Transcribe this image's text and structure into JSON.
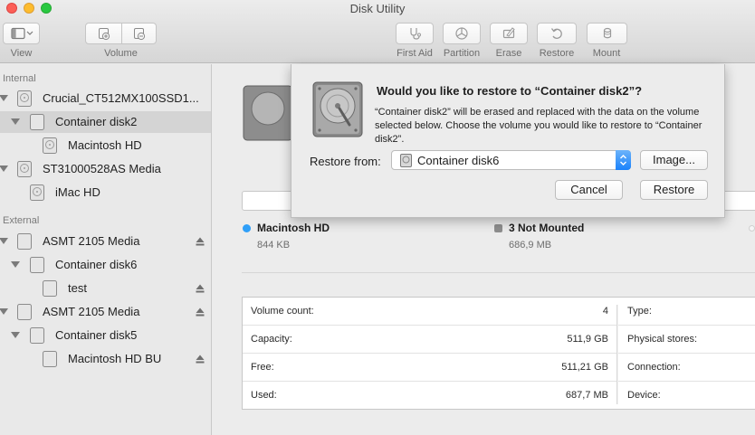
{
  "window": {
    "title": "Disk Utility"
  },
  "toolbar": {
    "view_label": "View",
    "volume_label": "Volume",
    "first_aid_label": "First Aid",
    "partition_label": "Partition",
    "erase_label": "Erase",
    "restore_label": "Restore",
    "mount_label": "Mount"
  },
  "sidebar": {
    "internal_header": "Internal",
    "external_header": "External",
    "items": [
      {
        "label": "Crucial_CT512MX100SSD1...",
        "kind": "drive"
      },
      {
        "label": "Container disk2",
        "kind": "container",
        "selected": true
      },
      {
        "label": "Macintosh HD",
        "kind": "volume"
      },
      {
        "label": "ST31000528AS Media",
        "kind": "drive"
      },
      {
        "label": "iMac HD",
        "kind": "volume"
      },
      {
        "label": "ASMT 2105 Media",
        "kind": "drive"
      },
      {
        "label": "Container disk6",
        "kind": "container"
      },
      {
        "label": "test",
        "kind": "volume"
      },
      {
        "label": "ASMT 2105 Media",
        "kind": "drive"
      },
      {
        "label": "Container disk5",
        "kind": "container"
      },
      {
        "label": "Macintosh HD BU",
        "kind": "volume"
      }
    ]
  },
  "main": {
    "legend": [
      {
        "name": "Macintosh HD",
        "size": "844 KB",
        "color": "#2f9ff8"
      },
      {
        "name": "3 Not Mounted",
        "size": "686,9 MB",
        "color": "#8e8e8e"
      }
    ],
    "info_left": [
      {
        "key": "Volume count:",
        "value": "4"
      },
      {
        "key": "Capacity:",
        "value": "511,9 GB"
      },
      {
        "key": "Free:",
        "value": "511,21 GB"
      },
      {
        "key": "Used:",
        "value": "687,7 MB"
      }
    ],
    "info_right": [
      {
        "key": "Type:"
      },
      {
        "key": "Physical stores:"
      },
      {
        "key": "Connection:"
      },
      {
        "key": "Device:"
      }
    ]
  },
  "dialog": {
    "title": "Would you like to restore to “Container disk2”?",
    "message": "“Container disk2” will be erased and replaced with the data on the volume selected below. Choose the volume you would like to restore to “Container disk2”.",
    "restore_from_label": "Restore from:",
    "restore_from_value": "Container disk6",
    "image_button": "Image...",
    "cancel_button": "Cancel",
    "restore_button": "Restore"
  },
  "colors": {
    "accent": "#1a82fb",
    "selection": "#d4d4d4"
  }
}
